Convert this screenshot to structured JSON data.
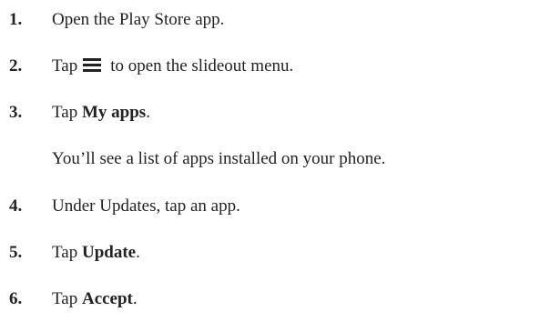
{
  "steps": [
    {
      "num": "1.",
      "text": "Open the Play Store app."
    },
    {
      "num": "2.",
      "before": "Tap",
      "icon": "menu-icon",
      "after": "to open the slideout menu."
    },
    {
      "num": "3.",
      "before": "Tap ",
      "bold": "My apps",
      "after": "."
    },
    {
      "note": "You’ll see a list of apps installed on your phone."
    },
    {
      "num": "4.",
      "text": "Under Updates, tap an app."
    },
    {
      "num": "5.",
      "before": "Tap ",
      "bold": "Update",
      "after": "."
    },
    {
      "num": "6.",
      "before": "Tap ",
      "bold": "Accept",
      "after": "."
    }
  ]
}
